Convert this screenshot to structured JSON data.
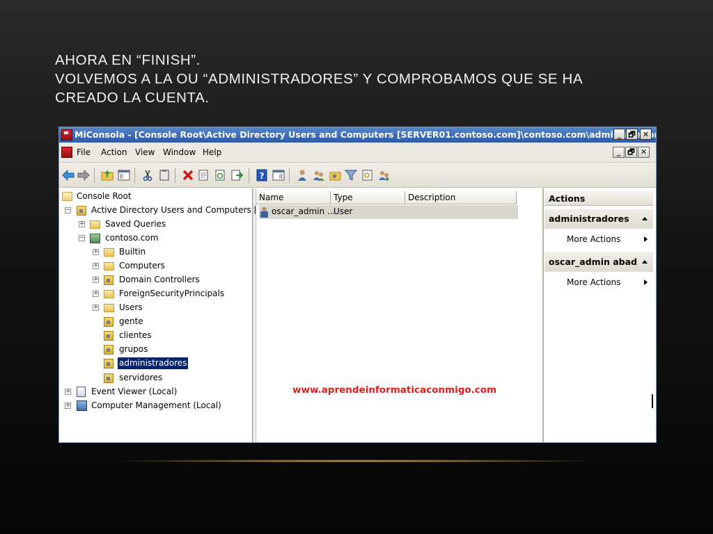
{
  "slide": {
    "title_line1": "AHORA EN “FINISH”.",
    "title_line2": "VOLVEMOS A LA OU “ADMINISTRADORES” Y COMPROBAMOS QUE SE HA",
    "title_line3": "CREADO LA CUENTA."
  },
  "window": {
    "title": "MiConsola - [Console Root\\Active Directory Users and Computers [SERVER01.contoso.com]\\contoso.com\\administradores]",
    "buttons": {
      "minimize": "_",
      "restore": "🗗",
      "close": "✕"
    }
  },
  "menu": {
    "items": [
      "File",
      "Action",
      "View",
      "Window",
      "Help"
    ]
  },
  "toolbar": {
    "icons": [
      "back-icon",
      "forward-icon",
      "up-folder-icon",
      "show-hide-tree-icon",
      "cut-icon",
      "copy-icon",
      "delete-icon",
      "properties-icon",
      "refresh-icon",
      "export-icon",
      "help-icon",
      "show-hide-action-pane-icon",
      "new-user-icon",
      "new-group-icon",
      "new-ou-icon",
      "filter-icon",
      "find-icon",
      "add-to-group-icon"
    ]
  },
  "tree": {
    "root": "Console Root",
    "aduc": "Active Directory Users and Computers [SERV",
    "saved_queries": "Saved Queries",
    "domain": "contoso.com",
    "builtin": "Builtin",
    "computers": "Computers",
    "domain_controllers": "Domain Controllers",
    "fsp": "ForeignSecurityPrincipals",
    "users": "Users",
    "gente": "gente",
    "clientes": "clientes",
    "grupos": "grupos",
    "administradores": "administradores",
    "servidores": "servidores",
    "event_viewer": "Event Viewer (Local)",
    "computer_mgmt": "Computer Management (Local)"
  },
  "list": {
    "columns": [
      "Name",
      "Type",
      "Description"
    ],
    "rows": [
      {
        "name": "oscar_admin ...",
        "type": "User",
        "description": ""
      }
    ],
    "watermark": "www.aprendeinformaticaconmigo.com"
  },
  "actions": {
    "header": "Actions",
    "section1": "administradores",
    "section1_item": "More Actions",
    "section2": "oscar_admin abad",
    "section2_item": "More Actions"
  },
  "colors": {
    "titlebar": "#3e6fb8",
    "selection": "#0a246a",
    "watermark": "#e01d1d",
    "slide_text": "#f2f2f2"
  }
}
